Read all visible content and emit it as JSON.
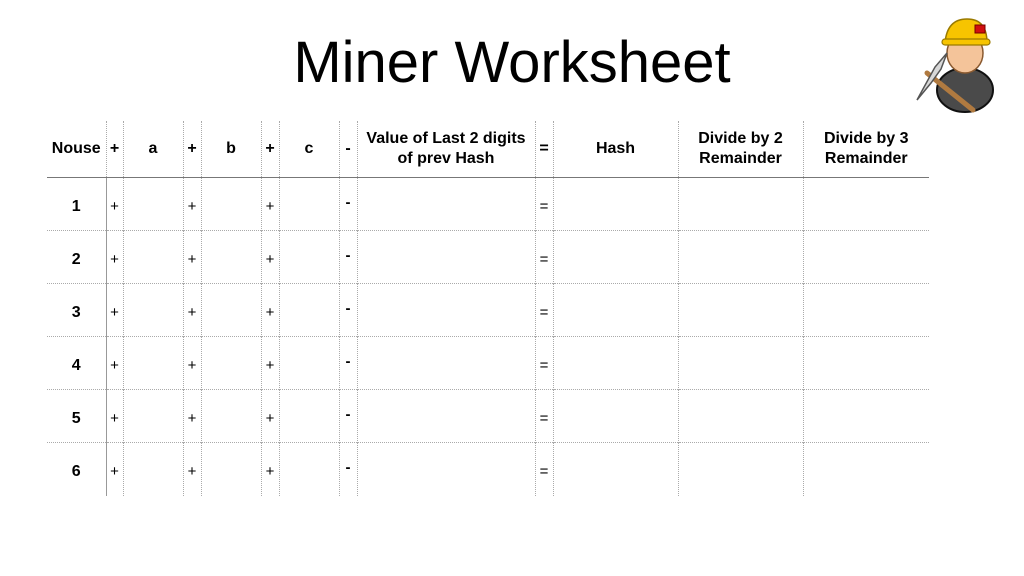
{
  "title": "Miner Worksheet",
  "header": {
    "nouse": "Nouse",
    "plus": "+",
    "a": "a",
    "b": "b",
    "c": "c",
    "minus": "-",
    "value_prev": "Value of Last 2 digits of prev Hash",
    "equals": "=",
    "hash": "Hash",
    "div2": "Divide by 2 Remainder",
    "div3": "Divide by 3 Remainder"
  },
  "rows": [
    {
      "nouse": "1"
    },
    {
      "nouse": "2"
    },
    {
      "nouse": "3"
    },
    {
      "nouse": "4"
    },
    {
      "nouse": "5"
    },
    {
      "nouse": "6"
    }
  ],
  "ops": {
    "plus": "+",
    "minus": "-",
    "equals": "="
  },
  "icons": {
    "miner": "miner-with-pickaxe-icon"
  }
}
